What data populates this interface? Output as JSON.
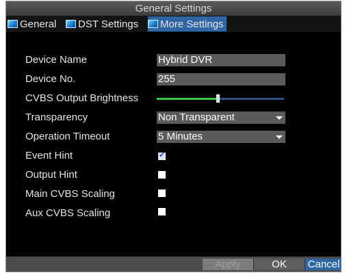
{
  "window": {
    "title": "General Settings"
  },
  "tabs": [
    {
      "label": "General",
      "active": false
    },
    {
      "label": "DST Settings",
      "active": false
    },
    {
      "label": "More Settings",
      "active": true
    }
  ],
  "form": {
    "device_name": {
      "label": "Device Name",
      "value": "Hybrid DVR"
    },
    "device_no": {
      "label": "Device No.",
      "value": "255"
    },
    "cvbs_brightness": {
      "label": "CVBS Output Brightness",
      "level_fraction": 0.48
    },
    "transparency": {
      "label": "Transparency",
      "value": "Non Transparent"
    },
    "operation_timeout": {
      "label": "Operation Timeout",
      "value": "5 Minutes"
    },
    "event_hint": {
      "label": "Event Hint",
      "checked": true
    },
    "output_hint": {
      "label": "Output Hint",
      "checked": false
    },
    "main_cvbs_scaling": {
      "label": "Main CVBS Scaling",
      "checked": false
    },
    "aux_cvbs_scaling": {
      "label": "Aux CVBS Scaling",
      "checked": false
    }
  },
  "buttons": {
    "apply": "Apply",
    "ok": "OK",
    "cancel": "Cancel"
  },
  "icons": {
    "tab_icon": "settings-tab-icon",
    "dropdown_arrow": "chevron-down-icon",
    "check": "check-icon"
  },
  "colors": {
    "accent": "#2f66a6",
    "slider_fill": "#2ecc40",
    "slider_track": "#2e4f86",
    "field_bg": "#5a5a5a"
  }
}
